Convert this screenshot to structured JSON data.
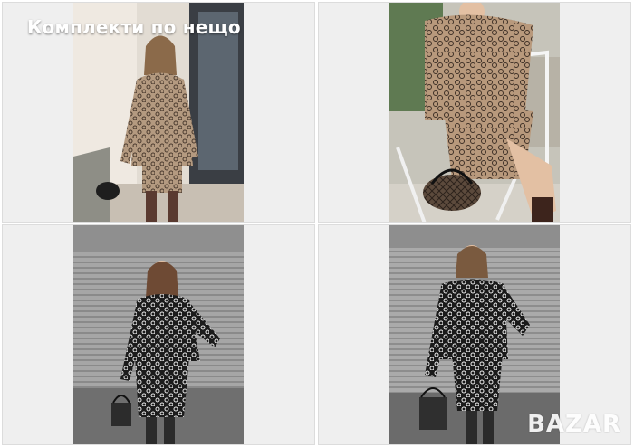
{
  "overlay": {
    "title": "Комплекти по нещо"
  },
  "watermark": {
    "text": "BAZAR"
  },
  "tiles": [
    {
      "alt": "tile 1"
    },
    {
      "alt": "tile 2"
    },
    {
      "alt": "tile 3"
    },
    {
      "alt": "tile 4"
    }
  ]
}
